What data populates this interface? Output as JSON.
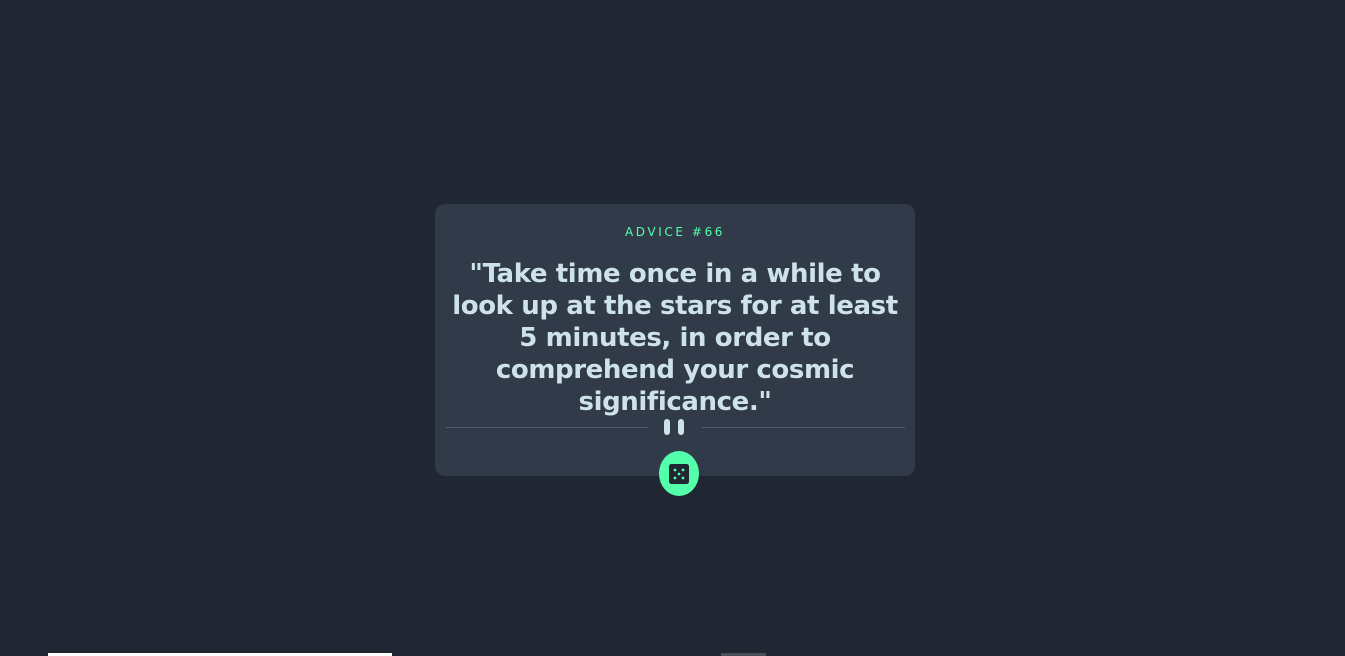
{
  "advice": {
    "label": "ADVICE #66",
    "quote": "\"Take time once in a while to look up at the stars for at least 5 minutes, in order to comprehend your cosmic significance.\""
  },
  "divider": {
    "icon": "pause-icon"
  },
  "dice_button": {
    "icon": "dice-icon"
  },
  "colors": {
    "background": "#202632",
    "card": "#313a49",
    "accent": "#53ffaa",
    "text": "#cee3e9",
    "divider": "#4f5d74"
  }
}
